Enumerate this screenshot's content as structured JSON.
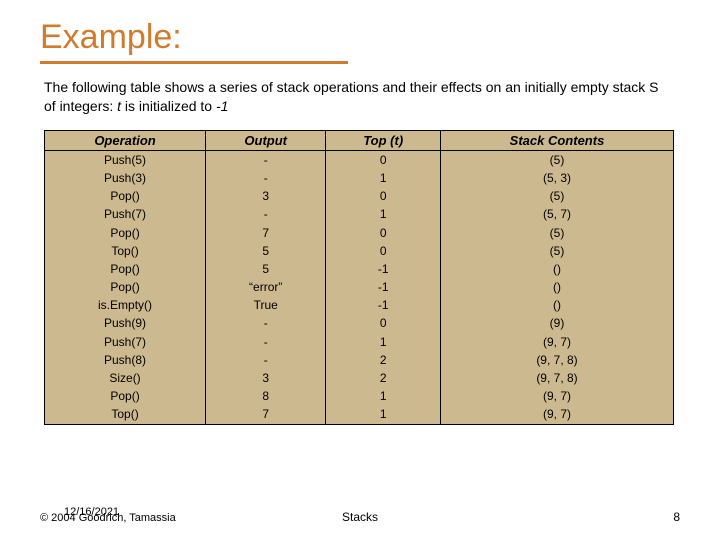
{
  "title": "Example:",
  "intro_part1": "The following table shows a series of stack operations and their effects on an initially empty stack S of integers:  ",
  "intro_t": "t",
  "intro_part2": " is initialized to ",
  "intro_neg1": "-1",
  "headers": {
    "operation": "Operation",
    "output": "Output",
    "top": "Top (t)",
    "contents": "Stack Contents"
  },
  "rows": [
    {
      "op": "Push(5)",
      "out": "-",
      "top": "0",
      "contents": "(5)"
    },
    {
      "op": "Push(3)",
      "out": "-",
      "top": "1",
      "contents": "(5, 3)"
    },
    {
      "op": "Pop()",
      "out": "3",
      "top": "0",
      "contents": "(5)"
    },
    {
      "op": "Push(7)",
      "out": "-",
      "top": "1",
      "contents": "(5, 7)"
    },
    {
      "op": "Pop()",
      "out": "7",
      "top": "0",
      "contents": "(5)"
    },
    {
      "op": "Top()",
      "out": "5",
      "top": "0",
      "contents": "(5)"
    },
    {
      "op": "Pop()",
      "out": "5",
      "top": "-1",
      "contents": "()"
    },
    {
      "op": "Pop()",
      "out": "“error”",
      "top": "-1",
      "contents": "()"
    },
    {
      "op": "is.Empty()",
      "out": "True",
      "top": "-1",
      "contents": "()"
    },
    {
      "op": "Push(9)",
      "out": "-",
      "top": "0",
      "contents": "(9)"
    },
    {
      "op": "Push(7)",
      "out": "-",
      "top": "1",
      "contents": "(9, 7)"
    },
    {
      "op": "Push(8)",
      "out": "-",
      "top": "2",
      "contents": "(9, 7, 8)"
    },
    {
      "op": "Size()",
      "out": "3",
      "top": "2",
      "contents": "(9, 7, 8)"
    },
    {
      "op": "Pop()",
      "out": "8",
      "top": "1",
      "contents": "(9, 7)"
    },
    {
      "op": "Top()",
      "out": "7",
      "top": "1",
      "contents": "(9, 7)"
    }
  ],
  "footer": {
    "left_line1": "12/16/2021",
    "left_line2": "© 2004 Goodrich, Tamassia",
    "center": "Stacks",
    "right": "8"
  }
}
